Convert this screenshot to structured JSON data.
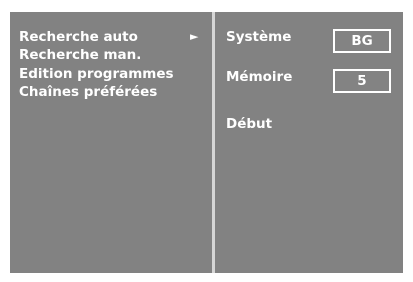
{
  "menu": {
    "items": [
      {
        "label": "Recherche auto"
      },
      {
        "label": "Recherche man."
      },
      {
        "label": "Edition programmes"
      },
      {
        "label": "Chaînes préférées"
      }
    ],
    "selected_arrow": "►"
  },
  "settings": {
    "systeme_label": "Système",
    "systeme_value": "BG",
    "memoire_label": "Mémoire",
    "memoire_value": "5",
    "debut_label": "Début"
  },
  "colors": {
    "background": "#828282",
    "text": "#ffffff",
    "divider": "#d6d6d6"
  }
}
